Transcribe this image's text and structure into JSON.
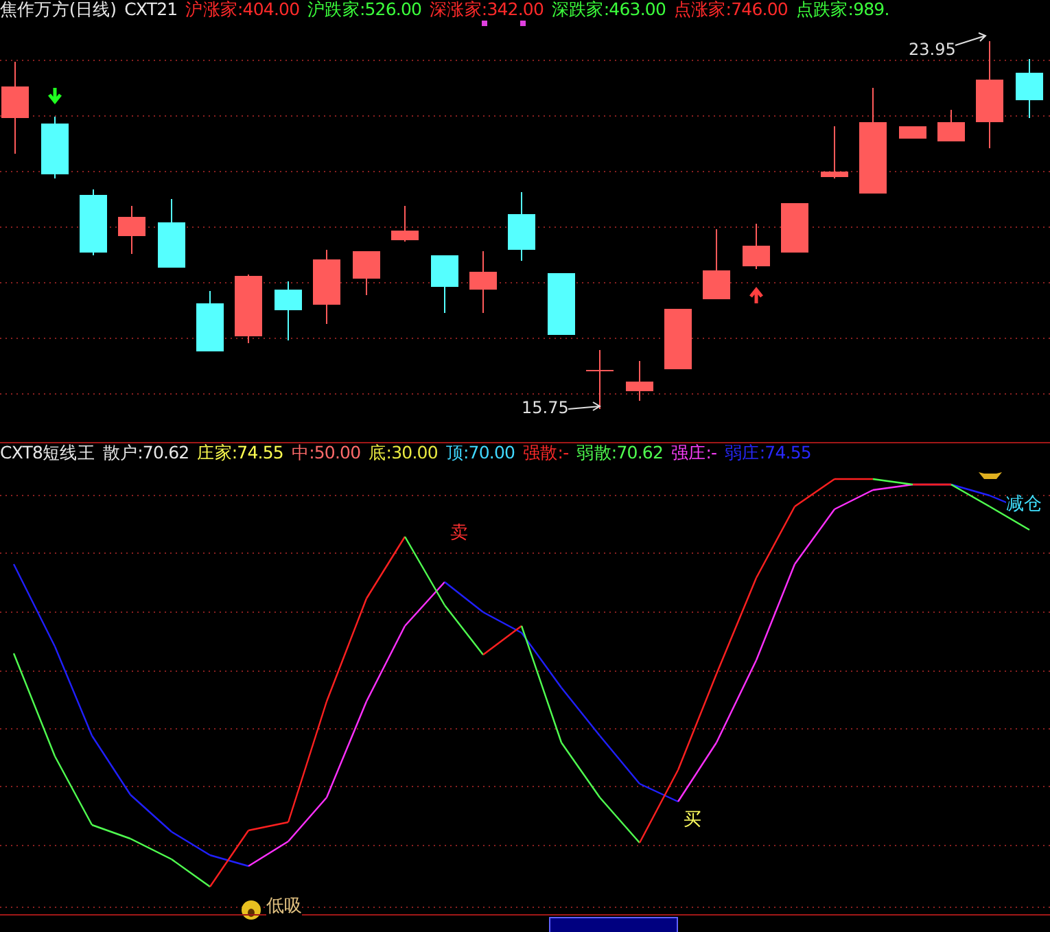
{
  "main_panel": {
    "title": "焦作万方(日线)",
    "indicator": "CXT21",
    "stats": [
      {
        "text": "沪涨家:404.00",
        "color": "#ff2a2a"
      },
      {
        "text": "沪跌家:526.00",
        "color": "#3cff3c"
      },
      {
        "text": "深涨家:342.00",
        "color": "#ff2a2a"
      },
      {
        "text": "深跌家:463.00",
        "color": "#3cff3c"
      },
      {
        "text": "点涨家:746.00",
        "color": "#ff2a2a"
      },
      {
        "text": "点跌家:989.",
        "color": "#3cff3c"
      }
    ],
    "price_labels": [
      {
        "kind": "low",
        "text": "15.75"
      },
      {
        "kind": "high",
        "text": "23.95"
      }
    ]
  },
  "indicator_panel": {
    "title": "CXT8短线王",
    "stats": [
      {
        "text": "散户:70.62",
        "color": "#e8e8e8"
      },
      {
        "text": "庄家:74.55",
        "color": "#ffff50"
      },
      {
        "text": "中:50.00",
        "color": "#ff6a6a"
      },
      {
        "text": "底:30.00",
        "color": "#e8e840"
      },
      {
        "text": "顶:70.00",
        "color": "#40d8ff"
      },
      {
        "text": "强散:-",
        "color": "#ff2a2a"
      },
      {
        "text": "弱散:70.62",
        "color": "#50ff50"
      },
      {
        "text": "强庄:-",
        "color": "#ff40ff"
      },
      {
        "text": "弱庄:74.55",
        "color": "#2828ff"
      }
    ],
    "signals": [
      {
        "kind": "sell",
        "text": "卖"
      },
      {
        "kind": "buy",
        "text": "买"
      },
      {
        "kind": "low_buy",
        "text": "低吸"
      },
      {
        "kind": "reduce",
        "text": "减仓"
      }
    ]
  }
}
